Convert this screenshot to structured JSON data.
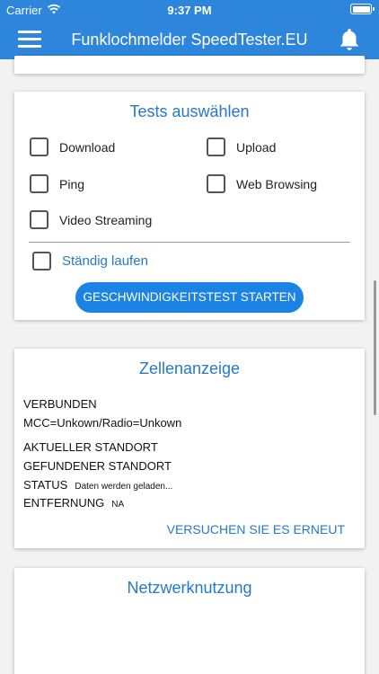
{
  "status_bar": {
    "carrier": "Carrier",
    "time": "9:37 PM"
  },
  "app_bar": {
    "title": "Funklochmelder SpeedTester.EU",
    "menu_icon": "hamburger-menu-icon",
    "bell_icon": "bell-icon"
  },
  "colors": {
    "brand": "#2e86dc",
    "accent_text": "#2479c8",
    "button": "#1b82e6"
  },
  "tests": {
    "title": "Tests auswählen",
    "options": [
      {
        "label": "Download",
        "checked": false
      },
      {
        "label": "Upload",
        "checked": false
      },
      {
        "label": "Ping",
        "checked": false
      },
      {
        "label": "Web Browsing",
        "checked": false
      },
      {
        "label": "Video Streaming",
        "checked": false
      }
    ],
    "always_run": {
      "label": "Ständig laufen",
      "checked": false
    },
    "start_button": "GESCHWINDIGKEITSTEST STARTEN"
  },
  "cell": {
    "title": "Zellenanzeige",
    "connected": "VERBUNDEN",
    "mcc": "MCC=Unkown/Radio=Unkown",
    "current_location": "AKTUELLER STANDORT",
    "found_location": "GEFUNDENER STANDORT",
    "status_label": "STATUS",
    "status_value": "Daten werden geladen...",
    "distance_label": "ENTFERNUNG",
    "distance_value": "NA",
    "retry": "VERSUCHEN SIE ES ERNEUT"
  },
  "network": {
    "title": "Netzwerknutzung"
  }
}
